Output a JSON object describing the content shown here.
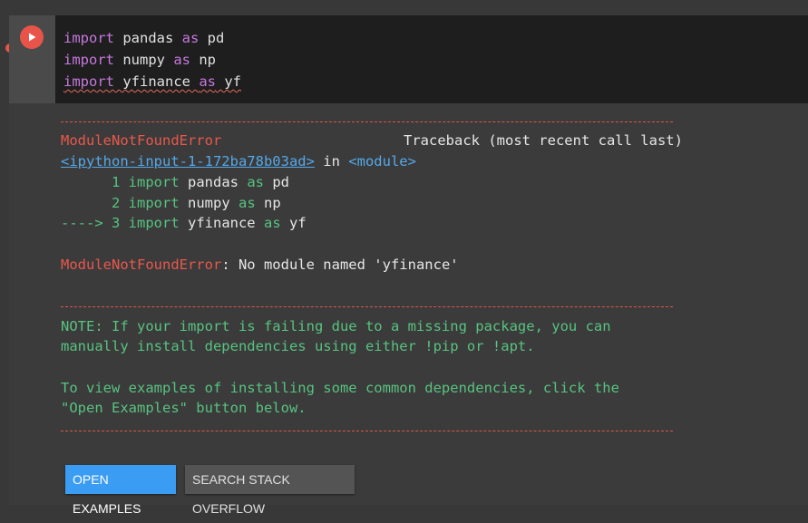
{
  "cell": {
    "code_lines": [
      {
        "kw": "import",
        "rest1": " pandas ",
        "kw2": "as",
        "rest2": " pd"
      },
      {
        "kw": "import",
        "rest1": " numpy ",
        "kw2": "as",
        "rest2": " np"
      },
      {
        "kw": "import",
        "rest1": " yfinance ",
        "kw2": "as",
        "rest2": " yf"
      }
    ]
  },
  "output": {
    "dash_rule": "-----------------------------------------------------------------------------",
    "error_name": "ModuleNotFoundError",
    "traceback_label": "Traceback (most recent call last)",
    "ipython_link": "<ipython-input-1-172ba78b03ad>",
    "in_text": " in ",
    "module_text": "<module>",
    "trace_lines": [
      {
        "prefix": "      1 ",
        "kw": "import",
        "rest1": " pandas ",
        "kw2": "as",
        "rest2": " pd"
      },
      {
        "prefix": "      2 ",
        "kw": "import",
        "rest1": " numpy ",
        "kw2": "as",
        "rest2": " np"
      },
      {
        "prefix": "----> 3 ",
        "kw": "import",
        "rest1": " yfinance ",
        "kw2": "as",
        "rest2": " yf"
      }
    ],
    "error_message": ": No module named 'yfinance'",
    "note_lines": [
      "NOTE: If your import is failing due to a missing package, you can",
      "manually install dependencies using either !pip or !apt.",
      "",
      "To view examples of installing some common dependencies, click the",
      "\"Open Examples\" button below."
    ]
  },
  "buttons": {
    "open_examples": "OPEN EXAMPLES",
    "search_stack_overflow": "SEARCH STACK OVERFLOW"
  },
  "colors": {
    "error": "#e8584d",
    "note": "#58c280",
    "link": "#55a8e8",
    "keyword": "#c678dd",
    "primary_button": "#3b9cf4"
  }
}
